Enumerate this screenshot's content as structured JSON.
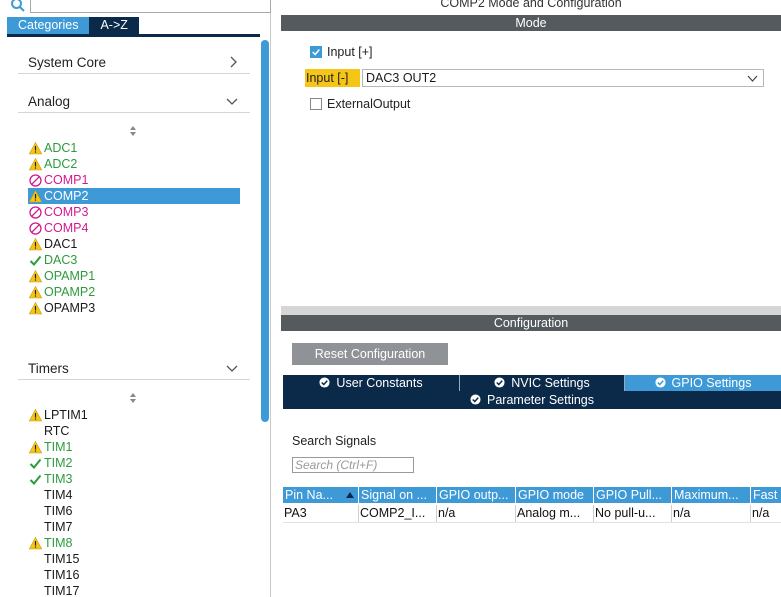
{
  "left": {
    "tabs": [
      {
        "label": "Categories"
      },
      {
        "label": "A->Z"
      }
    ],
    "sections": [
      {
        "title": "System Core"
      },
      {
        "title": "Analog"
      },
      {
        "title": "Timers"
      }
    ],
    "analog_items": [
      {
        "label": "ADC1",
        "status": "warning",
        "color": "#2e9a3e"
      },
      {
        "label": "ADC2",
        "status": "warning",
        "color": "#2e9a3e"
      },
      {
        "label": "COMP1",
        "status": "disabled",
        "color": "#d11a8d"
      },
      {
        "label": "COMP2",
        "status": "warning",
        "color": "#ffffff",
        "selected": true
      },
      {
        "label": "COMP3",
        "status": "disabled",
        "color": "#d11a8d"
      },
      {
        "label": "COMP4",
        "status": "disabled",
        "color": "#d11a8d"
      },
      {
        "label": "DAC1",
        "status": "warning",
        "color": "#1a1a1a"
      },
      {
        "label": "DAC3",
        "status": "ok",
        "color": "#2e9a3e"
      },
      {
        "label": "OPAMP1",
        "status": "warning",
        "color": "#2e9a3e"
      },
      {
        "label": "OPAMP2",
        "status": "warning",
        "color": "#2e9a3e"
      },
      {
        "label": "OPAMP3",
        "status": "warning",
        "color": "#1a1a1a"
      }
    ],
    "timer_items": [
      {
        "label": "LPTIM1",
        "status": "warning",
        "color": "#1a1a1a"
      },
      {
        "label": "RTC",
        "status": "none",
        "color": "#1a1a1a"
      },
      {
        "label": "TIM1",
        "status": "warning",
        "color": "#2e9a3e"
      },
      {
        "label": "TIM2",
        "status": "ok",
        "color": "#2e9a3e"
      },
      {
        "label": "TIM3",
        "status": "ok",
        "color": "#2e9a3e"
      },
      {
        "label": "TIM4",
        "status": "none",
        "color": "#1a1a1a"
      },
      {
        "label": "TIM6",
        "status": "none",
        "color": "#1a1a1a"
      },
      {
        "label": "TIM7",
        "status": "none",
        "color": "#1a1a1a"
      },
      {
        "label": "TIM8",
        "status": "warning",
        "color": "#2e9a3e"
      },
      {
        "label": "TIM15",
        "status": "none",
        "color": "#1a1a1a"
      },
      {
        "label": "TIM16",
        "status": "none",
        "color": "#1a1a1a"
      },
      {
        "label": "TIM17",
        "status": "none",
        "color": "#1a1a1a"
      }
    ]
  },
  "mode": {
    "window_title": "COMP2 Mode and Configuration",
    "bar_title": "Mode",
    "input_plus_label": "Input [+]",
    "input_plus_checked": true,
    "input_minus_label": "Input [-]",
    "input_minus_value": "DAC3 OUT2",
    "external_output_label": "ExternalOutput",
    "external_output_checked": false
  },
  "config": {
    "bar_title": "Configuration",
    "reset_label": "Reset Configuration",
    "tabs": [
      {
        "label": "User Constants"
      },
      {
        "label": "NVIC Settings"
      },
      {
        "label": "GPIO Settings",
        "active": true
      },
      {
        "label": "Parameter Settings"
      }
    ],
    "search_label": "Search Signals",
    "search_placeholder": "Search (Ctrl+F)",
    "table": {
      "headers": [
        "Pin Na...",
        "Signal on ...",
        "GPIO outp...",
        "GPIO mode",
        "GPIO Pull...",
        "Maximum...",
        "Fast"
      ],
      "rows": [
        [
          "PA3",
          "COMP2_I...",
          "n/a",
          "Analog m...",
          "No pull-u...",
          "n/a",
          "n/a"
        ]
      ]
    }
  },
  "colors": {
    "accent": "#3d9ad7",
    "navy": "#0b2a4a",
    "warning": "#f5c518",
    "ok": "#2e9a3e",
    "disabled": "#d11a8d"
  }
}
